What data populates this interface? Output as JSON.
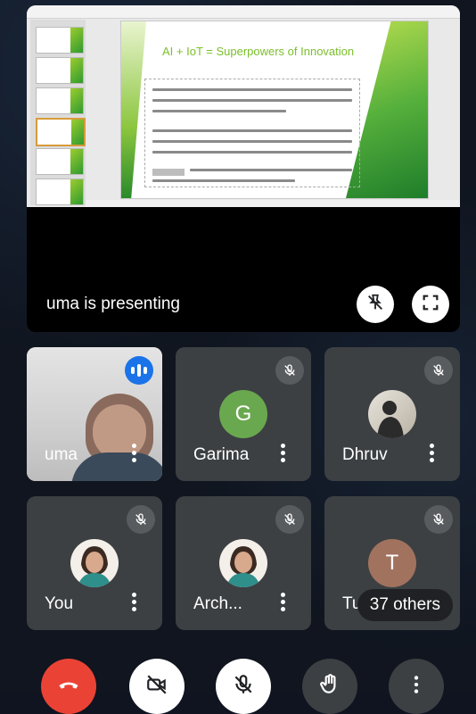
{
  "presentation": {
    "slide_title": "AI + IoT = Superpowers of Innovation",
    "presenting_label": "uma is presenting"
  },
  "participants": [
    {
      "name": "uma",
      "type": "video",
      "speaking": true
    },
    {
      "name": "Garima",
      "initial": "G",
      "avatar_color": "#6aa84f",
      "muted": true
    },
    {
      "name": "Dhruv",
      "type": "photo",
      "muted": true
    },
    {
      "name": "You",
      "type": "photo",
      "muted": true
    },
    {
      "name": "Arch...",
      "type": "photo",
      "muted": true
    },
    {
      "name": "Tu",
      "initial": "T",
      "avatar_color": "#a1725e",
      "muted": true,
      "others_label": "37 others"
    }
  ],
  "controls": {
    "end_call_color": "#ea4335",
    "items": [
      "end-call",
      "camera-off",
      "mic-off",
      "raise-hand",
      "more"
    ]
  },
  "colors": {
    "tile_bg": "#3c4043",
    "speaking_badge": "#1a73e8",
    "accent_green": "#7bbf2a"
  }
}
